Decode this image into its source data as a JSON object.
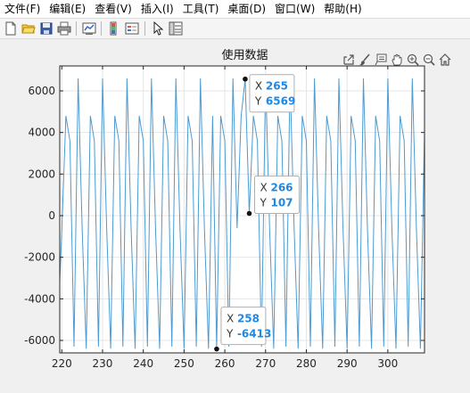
{
  "menu": {
    "items": [
      "文件(F)",
      "编辑(E)",
      "查看(V)",
      "插入(I)",
      "工具(T)",
      "桌面(D)",
      "窗口(W)",
      "帮助(H)"
    ]
  },
  "toolbar": {
    "icons": [
      "new-file-icon",
      "open-folder-icon",
      "save-icon",
      "print-icon",
      "link-plot-icon",
      "colorbar-icon",
      "legend-icon",
      "edit-plot-icon",
      "property-inspector-icon"
    ]
  },
  "axes_toolbar": {
    "icons": [
      "export-icon",
      "brush-icon",
      "datatip-icon",
      "pan-icon",
      "zoom-in-icon",
      "zoom-out-icon",
      "home-icon"
    ]
  },
  "colors": {
    "line": "#4d9bd1",
    "datatip_value": "#1e88e5",
    "grid": "#e6e6e6",
    "axis": "#262626"
  },
  "chart_data": {
    "type": "line",
    "title": "使用数据",
    "xlabel": "",
    "ylabel": "",
    "xlim": [
      219.5,
      309
    ],
    "ylim": [
      -6600,
      7200
    ],
    "grid": true,
    "xticks": [
      220,
      230,
      240,
      250,
      260,
      270,
      280,
      290,
      300
    ],
    "yticks": [
      -6000,
      -4000,
      -2000,
      0,
      2000,
      4000,
      6000
    ],
    "series": [
      {
        "x": [
          219,
          220,
          221,
          222,
          223,
          224,
          225,
          226,
          227,
          228,
          229,
          230,
          231,
          232,
          233,
          234,
          235,
          236,
          237,
          238,
          239,
          240,
          241,
          242,
          243,
          244,
          245,
          246,
          247,
          248,
          249,
          250,
          251,
          252,
          253,
          254,
          255,
          256,
          257,
          258,
          259,
          260,
          261,
          262,
          263,
          264,
          265,
          266,
          267,
          268,
          269,
          270,
          271,
          272,
          273,
          274,
          275,
          276,
          277,
          278,
          279,
          280,
          281,
          282,
          283,
          284,
          285,
          286,
          287,
          288,
          289,
          290,
          291,
          292,
          293,
          294,
          295,
          296,
          297,
          298,
          299,
          300,
          301,
          302,
          303,
          304,
          305,
          306,
          307,
          308,
          309
        ],
        "y": [
          -5600,
          -700,
          4800,
          3600,
          -6300,
          6600,
          -600,
          -6400,
          4800,
          3600,
          -6300,
          6600,
          -600,
          -6400,
          4800,
          3600,
          -6300,
          6600,
          -600,
          -6400,
          4800,
          3600,
          -6300,
          6600,
          -600,
          -6400,
          4800,
          3600,
          -6300,
          6600,
          -600,
          -6400,
          4800,
          3600,
          -6300,
          6600,
          -600,
          -6400,
          4800,
          -6413,
          4800,
          3600,
          -6300,
          6600,
          -600,
          4800,
          6569,
          107,
          4800,
          3600,
          -6300,
          6600,
          -600,
          -6400,
          4800,
          3600,
          -6300,
          6600,
          -600,
          -6400,
          4800,
          3600,
          -6300,
          6600,
          -600,
          -6400,
          4800,
          3600,
          -6300,
          6600,
          -600,
          -6400,
          4800,
          3600,
          -6300,
          6600,
          -600,
          -6400,
          4800,
          3600,
          -6300,
          6600,
          -600,
          -6400,
          4800,
          3600,
          -6300,
          6600,
          -600,
          -6400,
          4000
        ]
      }
    ],
    "datatips": [
      {
        "x": 265,
        "y": 6569,
        "x_label": "X",
        "y_label": "Y"
      },
      {
        "x": 266,
        "y": 107,
        "x_label": "X",
        "y_label": "Y"
      },
      {
        "x": 258,
        "y": -6413,
        "x_label": "X",
        "y_label": "Y"
      }
    ]
  }
}
